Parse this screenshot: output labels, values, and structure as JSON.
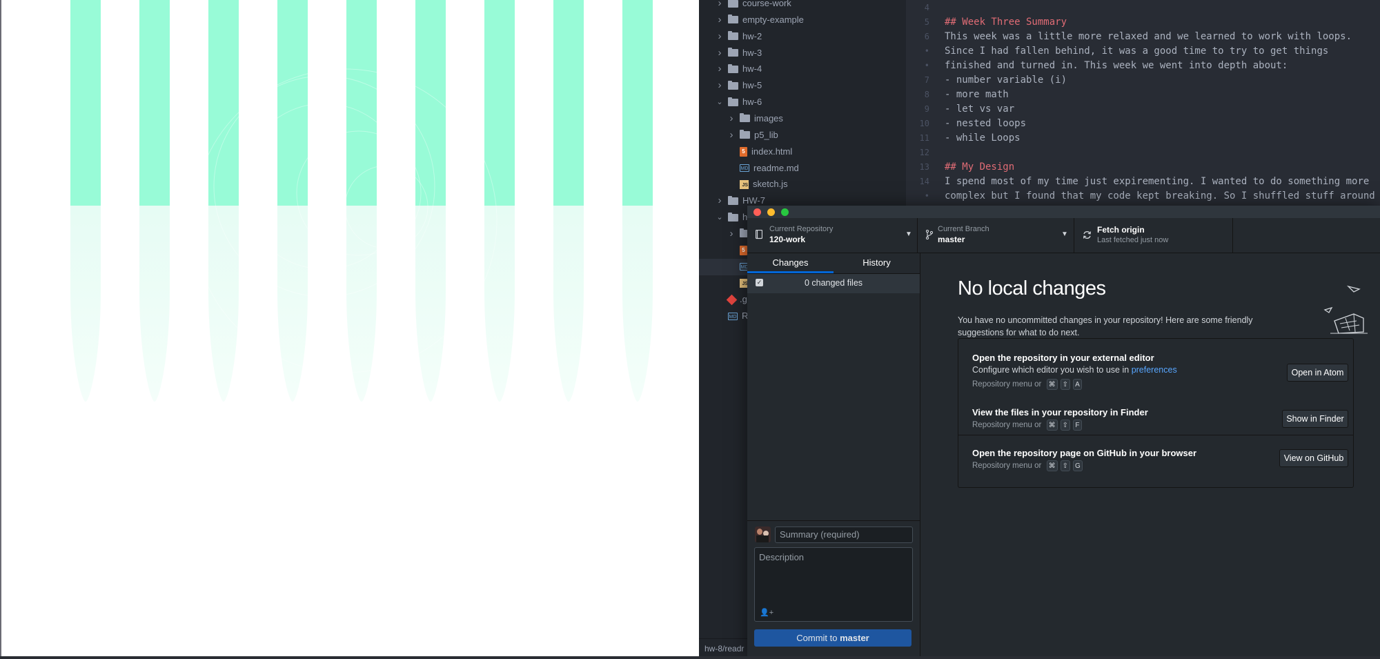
{
  "file_tree": [
    {
      "label": "course-work",
      "type": "folder",
      "indent": 0,
      "expanded": false
    },
    {
      "label": "empty-example",
      "type": "folder",
      "indent": 0,
      "expanded": false
    },
    {
      "label": "hw-2",
      "type": "folder",
      "indent": 0,
      "expanded": false
    },
    {
      "label": "hw-3",
      "type": "folder",
      "indent": 0,
      "expanded": false
    },
    {
      "label": "hw-4",
      "type": "folder",
      "indent": 0,
      "expanded": false
    },
    {
      "label": "hw-5",
      "type": "folder",
      "indent": 0,
      "expanded": false
    },
    {
      "label": "hw-6",
      "type": "folder",
      "indent": 0,
      "expanded": true
    },
    {
      "label": "images",
      "type": "folder",
      "indent": 1,
      "expanded": false
    },
    {
      "label": "p5_lib",
      "type": "folder",
      "indent": 1,
      "expanded": false
    },
    {
      "label": "index.html",
      "type": "html",
      "indent": 1
    },
    {
      "label": "readme.md",
      "type": "md",
      "indent": 1
    },
    {
      "label": "sketch.js",
      "type": "js",
      "indent": 1
    },
    {
      "label": "HW-7",
      "type": "folder",
      "indent": 0,
      "expanded": false
    },
    {
      "label": "hw",
      "type": "folder",
      "indent": 0,
      "expanded": true
    },
    {
      "label": "",
      "type": "folder",
      "indent": 1,
      "expanded": false
    },
    {
      "label": "",
      "type": "html",
      "indent": 1
    },
    {
      "label": "",
      "type": "md",
      "indent": 1,
      "selected": true
    },
    {
      "label": "",
      "type": "js",
      "indent": 1
    },
    {
      "label": ".g",
      "type": "git",
      "indent": 0
    },
    {
      "label": "RE",
      "type": "md",
      "indent": 0
    }
  ],
  "editor": {
    "lines": [
      {
        "num": "4",
        "text": "",
        "kind": "text"
      },
      {
        "num": "5",
        "text": "## Week Three Summary",
        "kind": "heading"
      },
      {
        "num": "6",
        "text": "This week was a little more relaxed and we learned to work with loops.",
        "kind": "text"
      },
      {
        "num": "•",
        "text": "Since I had fallen behind, it was a good time to try to get things",
        "kind": "text"
      },
      {
        "num": "•",
        "text": "finished and turned in. This week we went into depth about:",
        "kind": "text"
      },
      {
        "num": "7",
        "text": "- number variable (i)",
        "kind": "text"
      },
      {
        "num": "8",
        "text": "- more math",
        "kind": "text"
      },
      {
        "num": "9",
        "text": "- let vs var",
        "kind": "text"
      },
      {
        "num": "10",
        "text": "- nested loops",
        "kind": "text"
      },
      {
        "num": "11",
        "text": "- while Loops",
        "kind": "text"
      },
      {
        "num": "12",
        "text": "",
        "kind": "text"
      },
      {
        "num": "13",
        "text": "## My Design",
        "kind": "heading"
      },
      {
        "num": "14",
        "text": "I spend most of my time just expirementing. I wanted to do something more",
        "kind": "text"
      },
      {
        "num": "•",
        "text": "complex but I found that my code kept breaking. So I shuffled stuff around",
        "kind": "text"
      }
    ]
  },
  "statusbar": {
    "path": "hw-8/readr"
  },
  "github": {
    "toolbar": {
      "repo_label": "Current Repository",
      "repo_value": "120-work",
      "branch_label": "Current Branch",
      "branch_value": "master",
      "fetch_title": "Fetch origin",
      "fetch_sub": "Last fetched just now"
    },
    "tabs": {
      "changes": "Changes",
      "history": "History"
    },
    "changed_files": "0 changed files",
    "summary_placeholder": "Summary (required)",
    "description_placeholder": "Description",
    "commit_prefix": "Commit to ",
    "commit_branch": "master",
    "no_changes": {
      "title": "No local changes",
      "text": "You have no uncommitted changes in your repository! Here are some friendly suggestions for what to do next."
    },
    "cards": [
      {
        "title": "Open the repository in your external editor",
        "line": "Configure which editor you wish to use in ",
        "link": "preferences",
        "shortcut_prefix": "Repository menu or",
        "keys": [
          "⌘",
          "⇧",
          "A"
        ],
        "button": "Open in Atom"
      },
      {
        "title": "View the files in your repository in Finder",
        "shortcut_prefix": "Repository menu or",
        "keys": [
          "⌘",
          "⇧",
          "F"
        ],
        "button": "Show in Finder"
      },
      {
        "title": "Open the repository page on GitHub in your browser",
        "shortcut_prefix": "Repository menu or",
        "keys": [
          "⌘",
          "⇧",
          "G"
        ],
        "button": "View on GitHub"
      }
    ]
  },
  "colors": {
    "stripe": "#98fbd7",
    "stripe_fade": "#e9fdf5",
    "accent": "#0366d6",
    "commit_btn": "#1e56a0"
  }
}
